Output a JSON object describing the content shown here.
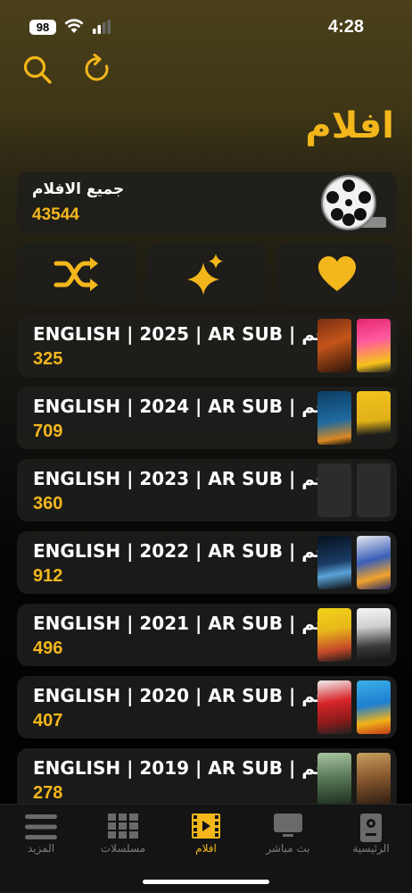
{
  "status_bar": {
    "battery": "98",
    "time": "4:28"
  },
  "header": {
    "title": "افلام",
    "search_icon": "search-icon",
    "refresh_icon": "refresh-icon"
  },
  "all_movies": {
    "label": "جميع الافلام",
    "count": "43544",
    "icon": "film-reel-icon"
  },
  "actions": [
    {
      "icon": "shuffle-icon"
    },
    {
      "icon": "sparkles-icon"
    },
    {
      "icon": "heart-icon"
    }
  ],
  "categories": [
    {
      "label": "ENGLISH | 2025 | AR SUB | زجم",
      "count": "325"
    },
    {
      "label": "ENGLISH | 2024 | AR SUB | زجم",
      "count": "709"
    },
    {
      "label": "ENGLISH | 2023 | AR SUB | زجم",
      "count": "360"
    },
    {
      "label": "ENGLISH | 2022 | AR SUB | زجم",
      "count": "912"
    },
    {
      "label": "ENGLISH | 2021 | AR SUB | زجم",
      "count": "496"
    },
    {
      "label": "ENGLISH | 2020 | AR SUB | زجم",
      "count": "407"
    },
    {
      "label": "ENGLISH | 2019 | AR SUB | زجم",
      "count": "278"
    }
  ],
  "tabbar": {
    "tabs": [
      {
        "label": "المزيد",
        "icon": "menu-icon"
      },
      {
        "label": "مسلسلات",
        "icon": "grid-icon"
      },
      {
        "label": "افلام",
        "icon": "film-icon",
        "active": true
      },
      {
        "label": "بث مباشر",
        "icon": "tv-icon"
      },
      {
        "label": "الرئيسية",
        "icon": "home-device-icon"
      }
    ]
  },
  "colors": {
    "accent": "#f3b71c",
    "inactive": "#7d7d7d"
  }
}
